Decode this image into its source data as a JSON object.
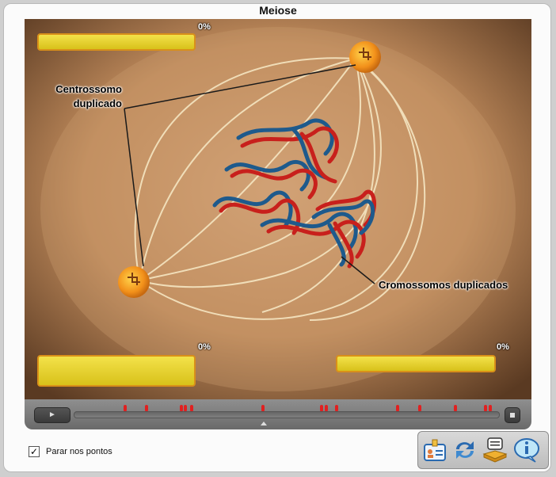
{
  "window": {
    "title": "Meiose"
  },
  "viewer": {
    "annotations": {
      "centrosome": "Centrossomo duplicado",
      "chromosomes": "Cromossomos duplicados"
    },
    "progress_boxes": [
      {
        "percent": "0%",
        "fill": 0
      },
      {
        "percent": "0%",
        "fill": 0
      },
      {
        "percent": "0%",
        "fill": 0
      }
    ]
  },
  "controls": {
    "play_icon": "play-icon",
    "stop_icon": "stop-icon",
    "marker_count": 14,
    "marker_color": "#e02020"
  },
  "options": {
    "stop_at_points_label": "Parar nos pontos",
    "stop_at_points_checked": true
  },
  "toolbar": {
    "icons": [
      "id-card-icon",
      "refresh-icon",
      "notes-book-icon",
      "info-icon"
    ]
  },
  "colors": {
    "highlight": "#f3e24a",
    "highlight_border": "#d99019",
    "chrom_red": "#c8201c",
    "chrom_blue": "#1e5a8c"
  }
}
